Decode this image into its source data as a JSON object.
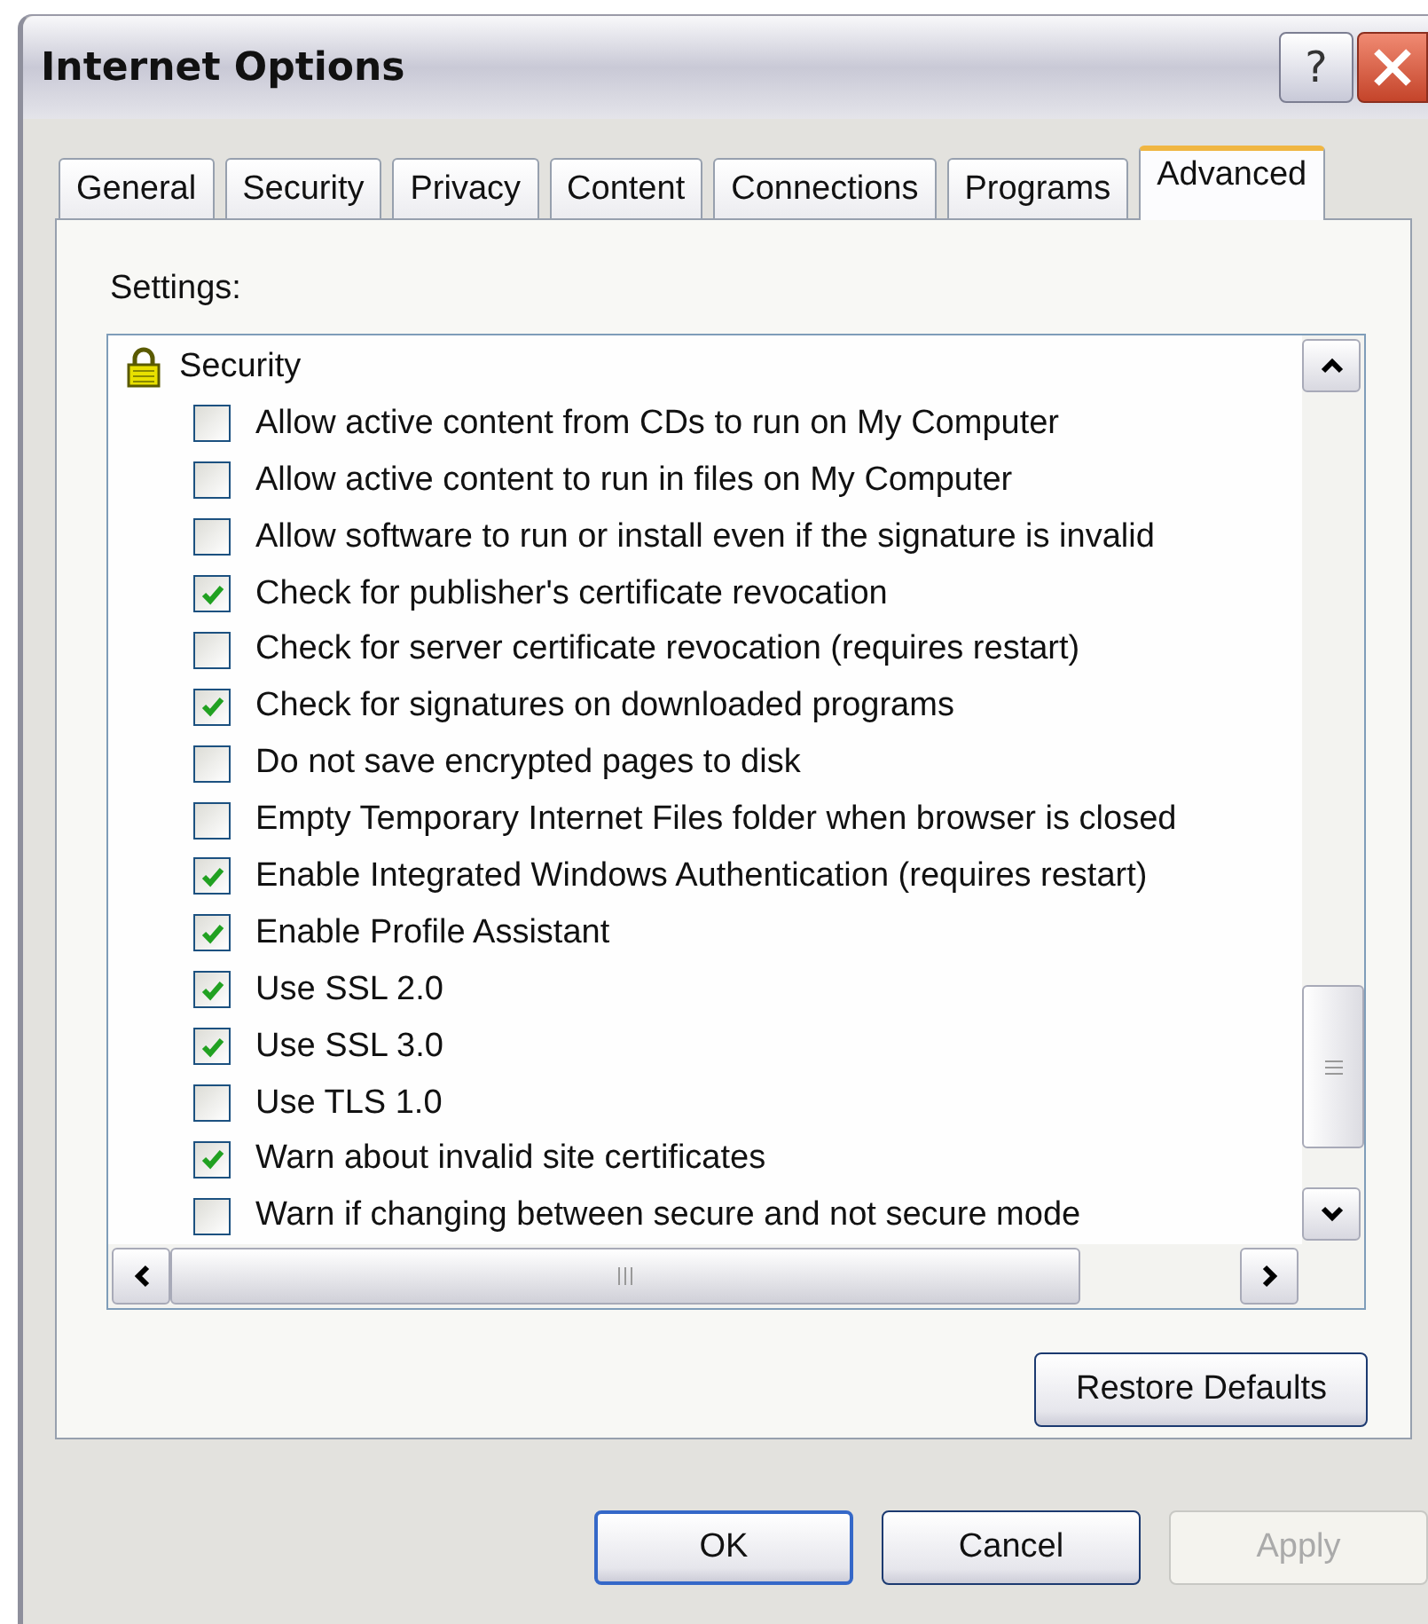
{
  "window": {
    "title": "Internet Options",
    "help_button": "?"
  },
  "tabs": [
    {
      "label": "General",
      "selected": false
    },
    {
      "label": "Security",
      "selected": false
    },
    {
      "label": "Privacy",
      "selected": false
    },
    {
      "label": "Content",
      "selected": false
    },
    {
      "label": "Connections",
      "selected": false
    },
    {
      "label": "Programs",
      "selected": false
    },
    {
      "label": "Advanced",
      "selected": true
    }
  ],
  "settings_label": "Settings:",
  "settings": {
    "group": "Security",
    "items": [
      {
        "label": "Allow active content from CDs to run on My Computer",
        "checked": false
      },
      {
        "label": "Allow active content to run in files on My Computer",
        "checked": false
      },
      {
        "label": "Allow software to run or install even if the signature is invalid",
        "checked": false
      },
      {
        "label": "Check for publisher's certificate revocation",
        "checked": true
      },
      {
        "label": "Check for server certificate revocation (requires restart)",
        "checked": false
      },
      {
        "label": "Check for signatures on downloaded programs",
        "checked": true
      },
      {
        "label": "Do not save encrypted pages to disk",
        "checked": false
      },
      {
        "label": "Empty Temporary Internet Files folder when browser is closed",
        "checked": false
      },
      {
        "label": "Enable Integrated Windows Authentication (requires restart)",
        "checked": true
      },
      {
        "label": "Enable Profile Assistant",
        "checked": true
      },
      {
        "label": "Use SSL 2.0",
        "checked": true
      },
      {
        "label": "Use SSL 3.0",
        "checked": true
      },
      {
        "label": "Use TLS 1.0",
        "checked": false
      },
      {
        "label": "Warn about invalid site certificates",
        "checked": true
      },
      {
        "label": "Warn if changing between secure and not secure mode",
        "checked": false
      }
    ]
  },
  "restore_button": "Restore Defaults",
  "buttons": [
    {
      "label": "OK",
      "disabled": false,
      "default": true
    },
    {
      "label": "Cancel",
      "disabled": false,
      "default": false
    },
    {
      "label": "Apply",
      "disabled": true,
      "default": false
    }
  ]
}
